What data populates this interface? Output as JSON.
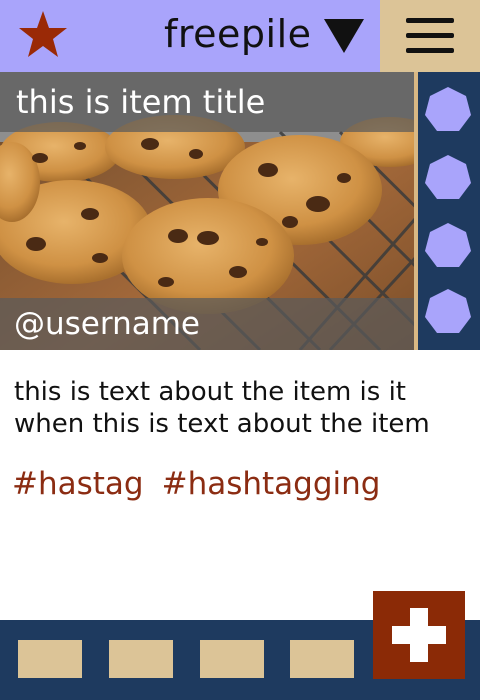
{
  "header": {
    "app_title": "freepile",
    "icons": {
      "favorite": "star-icon",
      "dropdown": "caret-down-icon",
      "menu": "hamburger-menu-icon"
    }
  },
  "item": {
    "title": "this is item title",
    "username": "@username",
    "description": "this is text about the item is it when this is text about the item",
    "hashtags": [
      "#hastag",
      "#hashtagging"
    ]
  },
  "side_rail": {
    "button_count": 4,
    "icon": "heptagon-icon"
  },
  "footer": {
    "tab_count": 4,
    "add_icon": "plus-icon"
  },
  "colors": {
    "header_bg": "#a9a4fb",
    "menu_bg": "#dcc497",
    "rail_bg": "#1e3a5f",
    "accent": "#8b2c12",
    "rail_button": "#a9a4fb",
    "footer_button": "#dcc497"
  }
}
